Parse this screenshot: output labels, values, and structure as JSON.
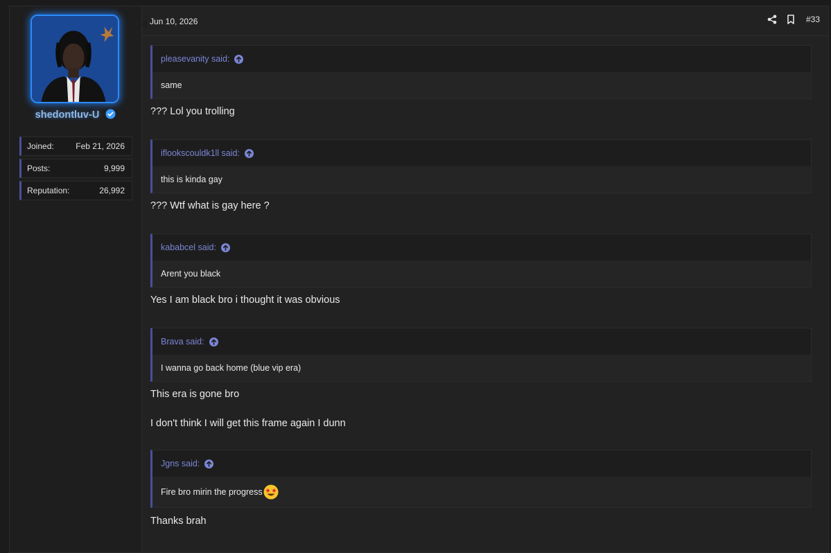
{
  "post": {
    "date": "Jun 10, 2026",
    "number": "#33",
    "user": {
      "name": "shedontluv-U",
      "verified_icon": "verified-check-icon",
      "stats": [
        {
          "label": "Joined:",
          "value": "Feb 21, 2026"
        },
        {
          "label": "Posts:",
          "value": "9,999"
        },
        {
          "label": "Reputation:",
          "value": "26,992"
        }
      ]
    },
    "blocks": [
      {
        "quote_author": "pleasevanity said:",
        "quote_text": "same",
        "reply": "??? Lol you trolling"
      },
      {
        "quote_author": "iflookscouldk1ll said:",
        "quote_text": "this is kinda gay",
        "reply": "??? Wtf what is gay here ?"
      },
      {
        "quote_author": "kababcel said:",
        "quote_text": "Arent you black",
        "reply": "Yes I am black bro i thought it was obvious"
      },
      {
        "quote_author": "Brava said:",
        "quote_text": "I wanna go back home (blue vip era)",
        "reply": "This era is gone bro",
        "reply2": "I don't think I will get this frame again I dunn"
      },
      {
        "quote_author": "Jgns said:",
        "quote_text": "Fire bro mirin the progress",
        "reply": "Thanks brah"
      }
    ]
  },
  "icons": {
    "share": "share-icon",
    "bookmark": "bookmark-icon",
    "quote_jump": "arrow-up-circle-icon",
    "emoji": "star-struck-emoji"
  },
  "colors": {
    "accent": "#4b4f9a",
    "quote_author": "#7b86d6",
    "avatar_glow": "#2a8cff",
    "verified": "#3a9bff"
  }
}
